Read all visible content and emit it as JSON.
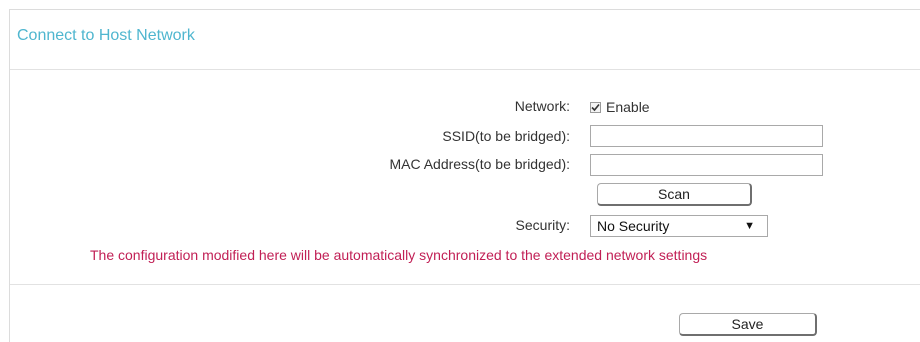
{
  "panel": {
    "title": "Connect to Host Network"
  },
  "form": {
    "network_label": "Network:",
    "enable_label": "Enable",
    "enable_checked": true,
    "ssid_label": "SSID(to be bridged):",
    "ssid_value": "",
    "mac_label": "MAC Address(to be bridged):",
    "mac_value": "",
    "scan_label": "Scan",
    "security_label": "Security:",
    "security_selected": "No Security",
    "notice": "The configuration modified here will be automatically synchronized to the extended network settings"
  },
  "footer": {
    "save_label": "Save"
  },
  "colors": {
    "title": "#4fb6cf",
    "notice": "#c11f55"
  }
}
